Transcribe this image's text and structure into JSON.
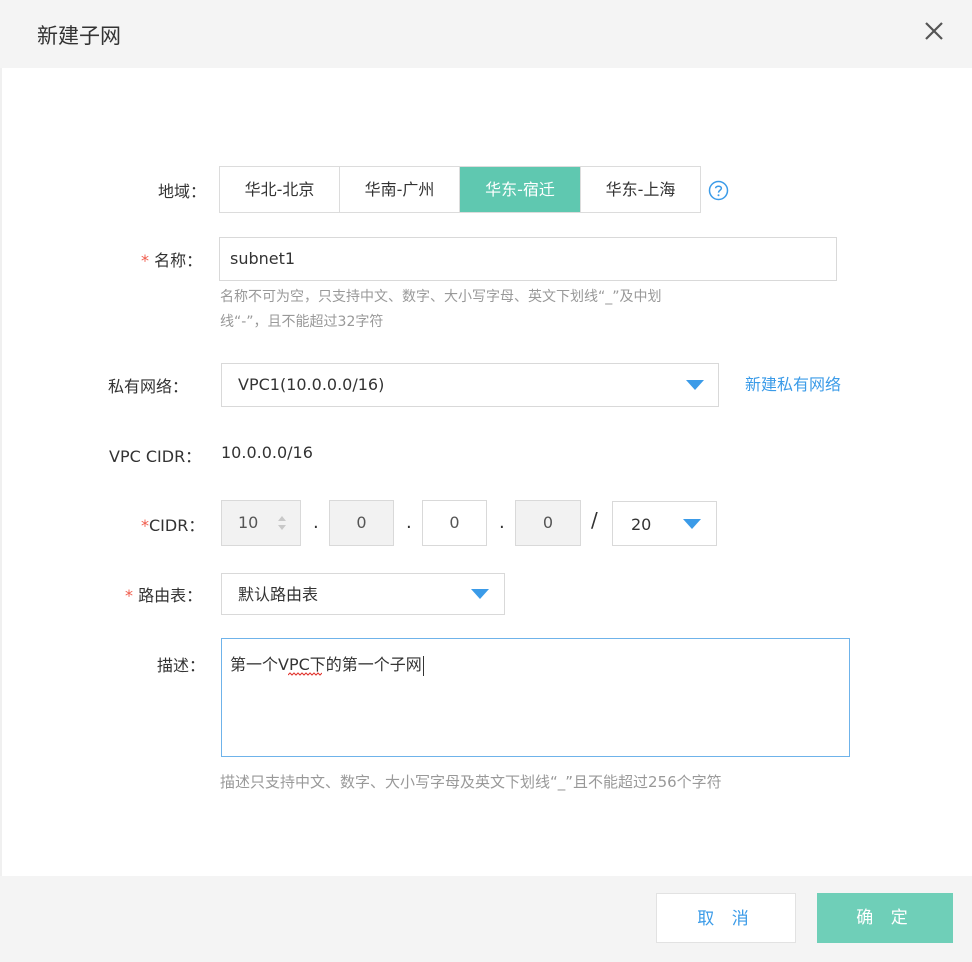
{
  "dialog": {
    "title": "新建子网",
    "close_icon": "close-icon"
  },
  "region": {
    "label": "地域：",
    "tabs": [
      "华北-北京",
      "华南-广州",
      "华东-宿迁",
      "华东-上海"
    ],
    "active_index": 2,
    "help_icon": "question-circle-icon"
  },
  "name": {
    "required_mark": "*",
    "label": "名称：",
    "value": "subnet1",
    "hint_line1": "名称不可为空，只支持中文、数字、大小写字母、英文下划线“_”及中划",
    "hint_line2": "线“-”，且不能超过32字符"
  },
  "vpc": {
    "label": "私有网络：",
    "selected": "VPC1(10.0.0.0/16)",
    "new_link": "新建私有网络"
  },
  "vpc_cidr": {
    "label": "VPC CIDR：",
    "value": "10.0.0.0/16"
  },
  "cidr": {
    "required_mark": "*",
    "label": "CIDR：",
    "octets": [
      "10",
      "0",
      "0",
      "0"
    ],
    "dots": [
      ".",
      ".",
      "."
    ],
    "slash": "/",
    "mask": "20"
  },
  "route_table": {
    "required_mark": "*",
    "label": "路由表：",
    "selected": "默认路由表"
  },
  "description": {
    "label": "描述：",
    "value": "第一个VPC下的第一个子网",
    "hint": "描述只支持中文、数字、大小写字母及英文下划线“_”且不能超过256个字符"
  },
  "footer": {
    "cancel_label": "取 消",
    "ok_label": "确 定"
  },
  "colors": {
    "accent_teal": "#5fc8b0",
    "link_blue": "#3b9be8",
    "required_red": "#f05a4a"
  }
}
